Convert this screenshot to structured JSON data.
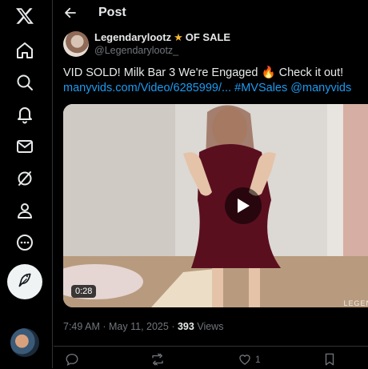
{
  "nav": {
    "items": [
      {
        "icon": "x-logo-icon"
      },
      {
        "icon": "home-icon"
      },
      {
        "icon": "explore-icon"
      },
      {
        "icon": "notifications-icon"
      },
      {
        "icon": "messages-icon"
      },
      {
        "icon": "grok-icon"
      },
      {
        "icon": "profile-icon"
      },
      {
        "icon": "more-icon"
      }
    ],
    "post_button_icon": "feather-icon"
  },
  "header": {
    "title": "Post"
  },
  "post": {
    "author_name": "Legendarylootz",
    "author_badge_icon": "star-icon",
    "author_suffix": "OF SALE",
    "handle": "@Legendarylootz_",
    "text_main": "VID SOLD! Milk Bar 3 We're Engaged ",
    "text_after_emoji": " Check it out!",
    "link_url": "manyvids.com/Video/6285999/...",
    "hashtag": "#MVSales",
    "mention": "@manyvids",
    "video_duration": "0:28",
    "watermark": "LEGEN",
    "time": "7:49 AM",
    "date": "May 11, 2025",
    "views_count": "393",
    "views_label": "Views",
    "likes_count": "1"
  },
  "colors": {
    "accent": "#1d9bf0",
    "background": "#000000",
    "text": "#e7e9ea",
    "muted": "#71767b"
  }
}
